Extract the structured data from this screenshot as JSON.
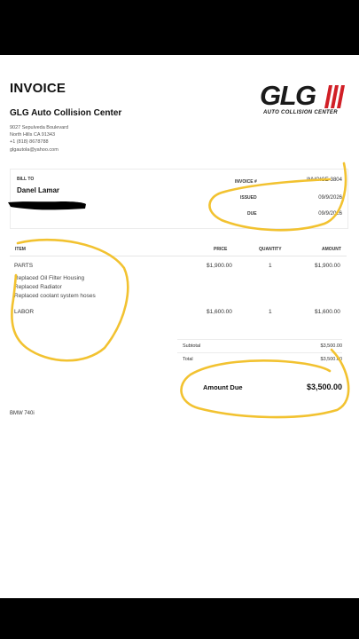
{
  "invoice": {
    "title": "INVOICE",
    "company": "GLG Auto Collision Center",
    "address_lines": [
      "9027 Sepulveda Boulevard",
      "North Hills CA 91343",
      "+1 (818) 8678788",
      "glgautola@yahoo.com"
    ],
    "logo": {
      "text": "GLG",
      "tagline": "AUTO COLLISION CENTER",
      "color": "#d11f26"
    },
    "bill_to_label": "BILL TO",
    "bill_to_name": "Danel Lamar",
    "meta": [
      {
        "label": "INVOICE #",
        "value": "INVOICE-3804"
      },
      {
        "label": "ISSUED",
        "value": "09/9/2026"
      },
      {
        "label": "DUE",
        "value": "09/9/2026"
      }
    ],
    "columns": {
      "item": "ITEM",
      "price": "PRICE",
      "quantity": "QUANTITY",
      "amount": "AMOUNT"
    },
    "line_items": [
      {
        "item": "PARTS",
        "price": "$1,900.00",
        "quantity": "1",
        "amount": "$1,900.00",
        "details": [
          "Replaced Oil Filter Housing",
          "Replaced Radiator",
          "Replaced coolant system hoses"
        ]
      },
      {
        "item": "LABOR",
        "price": "$1,600.00",
        "quantity": "1",
        "amount": "$1,600.00",
        "details": []
      }
    ],
    "subtotal_label": "Subtotal",
    "subtotal": "$3,500.00",
    "total_label": "Total",
    "total": "$3,500.00",
    "amount_due_label": "Amount Due",
    "amount_due": "$3,500.00",
    "note": "BMW 740i",
    "highlight_color": "#f2c230"
  }
}
